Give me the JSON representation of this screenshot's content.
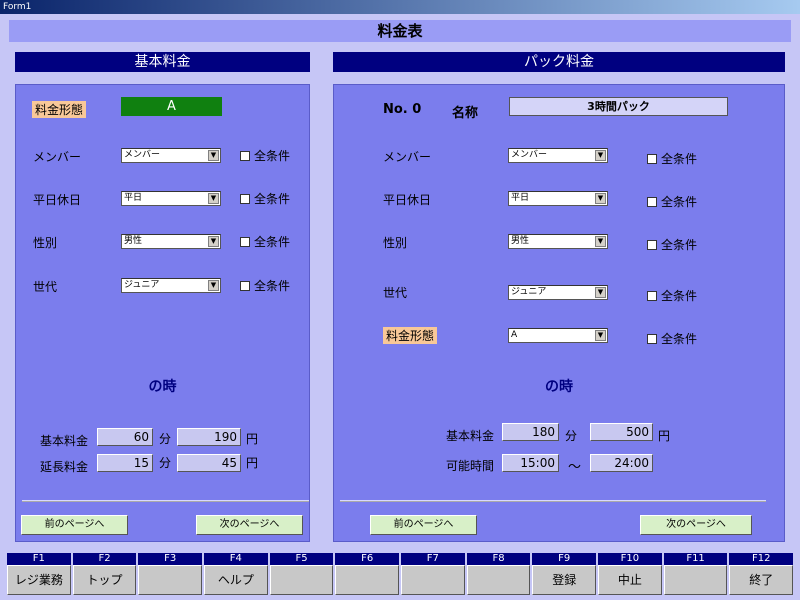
{
  "window": {
    "title": "Form1"
  },
  "page_title": "料金表",
  "basic": {
    "header": "基本料金",
    "pricing_type_label": "料金形態",
    "pricing_type_value": "A",
    "rows": [
      {
        "label": "メンバー",
        "value": "メンバー",
        "check": "全条件"
      },
      {
        "label": "平日休日",
        "value": "平日",
        "check": "全条件"
      },
      {
        "label": "性別",
        "value": "男性",
        "check": "全条件"
      },
      {
        "label": "世代",
        "value": "ジュニア",
        "check": "全条件"
      }
    ],
    "when_label": "の時",
    "fee_label": "基本料金",
    "fee_minutes": "60",
    "fee_yen": "190",
    "ext_label": "延長料金",
    "ext_minutes": "15",
    "ext_yen": "45",
    "unit_min": "分",
    "unit_yen": "円",
    "prev_btn": "前のページへ",
    "next_btn": "次のページへ"
  },
  "pack": {
    "header": "パック料金",
    "no_label": "No. 0",
    "name_label": "名称",
    "name_value": "3時間パック",
    "rows": [
      {
        "label": "メンバー",
        "value": "メンバー",
        "check": "全条件"
      },
      {
        "label": "平日休日",
        "value": "平日",
        "check": "全条件"
      },
      {
        "label": "性別",
        "value": "男性",
        "check": "全条件"
      },
      {
        "label": "世代",
        "value": "ジュニア",
        "check": "全条件"
      },
      {
        "label": "料金形態",
        "value": "A",
        "check": "全条件"
      }
    ],
    "when_label": "の時",
    "fee_label": "基本料金",
    "fee_minutes": "180",
    "fee_yen": "500",
    "time_label": "可能時間",
    "time_from": "15:00",
    "time_sep": "～",
    "time_to": "24:00",
    "unit_min": "分",
    "unit_yen": "円",
    "prev_btn": "前のページへ",
    "next_btn": "次のページへ"
  },
  "fkeys": [
    {
      "key": "F1",
      "label": "レジ業務"
    },
    {
      "key": "F2",
      "label": "トップ"
    },
    {
      "key": "F3",
      "label": ""
    },
    {
      "key": "F4",
      "label": "ヘルプ"
    },
    {
      "key": "F5",
      "label": ""
    },
    {
      "key": "F6",
      "label": ""
    },
    {
      "key": "F7",
      "label": ""
    },
    {
      "key": "F8",
      "label": ""
    },
    {
      "key": "F9",
      "label": "登録"
    },
    {
      "key": "F10",
      "label": "中止"
    },
    {
      "key": "F11",
      "label": ""
    },
    {
      "key": "F12",
      "label": "終了"
    }
  ]
}
